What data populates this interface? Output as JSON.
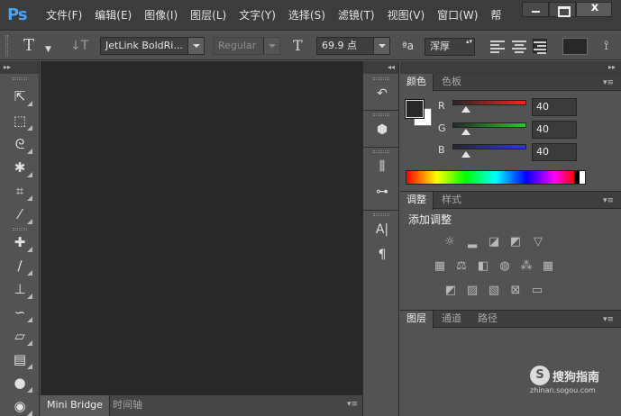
{
  "app": {
    "logo": "Ps"
  },
  "menubar": {
    "items": [
      "文件(F)",
      "编辑(E)",
      "图像(I)",
      "图层(L)",
      "文字(Y)",
      "选择(S)",
      "滤镜(T)",
      "视图(V)",
      "窗口(W)",
      "帮"
    ],
    "close_label": "x"
  },
  "options": {
    "font_family": "JetLink BoldRi...",
    "font_style": "Regular",
    "font_size": "69.9 点",
    "antialias_icon": "ªa",
    "antialias": "浑厚",
    "text_tool_glyph": "T",
    "size_glyph": "T"
  },
  "tools": {
    "top_marker": "▸▸"
  },
  "bottom_tabs": [
    "Mini Bridge",
    "时间轴"
  ],
  "dock": {
    "top_marker": "◂◂"
  },
  "color_panel": {
    "tabs": [
      "颜色",
      "色板"
    ],
    "channels": [
      {
        "label": "R",
        "value": "40",
        "color": "#ff2020"
      },
      {
        "label": "G",
        "value": "40",
        "color": "#20d020"
      },
      {
        "label": "B",
        "value": "40",
        "color": "#3030ff"
      }
    ],
    "foreground": "#282828",
    "background": "#ffffff"
  },
  "adjustments_panel": {
    "tabs": [
      "调整",
      "样式"
    ],
    "title": "添加调整"
  },
  "layers_panel": {
    "tabs": [
      "图层",
      "通道",
      "路径"
    ]
  },
  "watermark": {
    "logo": "S",
    "text": "搜狗指南",
    "url": "zhinan.sogou.com"
  },
  "panel_menu_glyph": "▾≡"
}
